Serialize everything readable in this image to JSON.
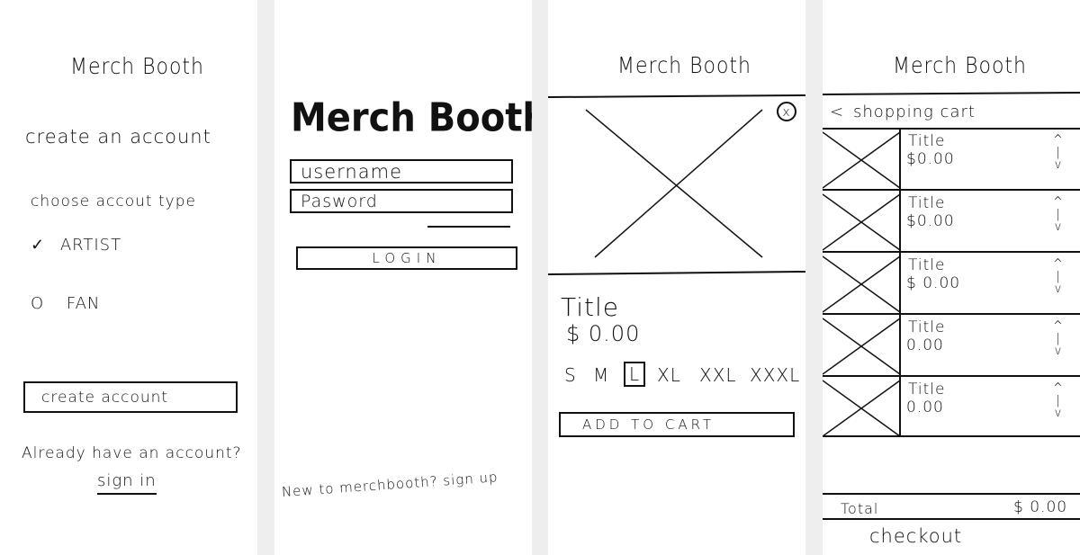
{
  "signup": {
    "brand": "Merch Booth",
    "heading": "create an account",
    "account_type_label": "choose accout type",
    "options": [
      {
        "mark": "✓",
        "label": "ARTIST"
      },
      {
        "mark": "O",
        "label": "FAN"
      }
    ],
    "create_button": "create account",
    "already_text": "Already have an account?",
    "sign_in_link": "sign in"
  },
  "login": {
    "brand": "Merch Booth",
    "username_placeholder": "username",
    "password_placeholder": "Pasword",
    "login_button": "LOGIN",
    "footer_text": "New to merchbooth? sign up"
  },
  "product": {
    "brand": "Merch Booth",
    "close_glyph": "x",
    "title": "Title",
    "price": "$ 0.00",
    "sizes": [
      {
        "label": "S",
        "selected": false
      },
      {
        "label": "M",
        "selected": false
      },
      {
        "label": "L",
        "selected": true
      },
      {
        "label": "XL",
        "selected": false
      },
      {
        "label": "XXL",
        "selected": false
      },
      {
        "label": "XXXL",
        "selected": false
      }
    ],
    "add_to_cart": "ADD TO CART"
  },
  "cart": {
    "brand": "Merch Booth",
    "back_glyph": "<",
    "heading": "shopping cart",
    "items": [
      {
        "title": "Title",
        "price": "$0.00"
      },
      {
        "title": "Title",
        "price": "$0.00"
      },
      {
        "title": "Title",
        "price": "$ 0.00"
      },
      {
        "title": "Title",
        "price": "0.00"
      },
      {
        "title": "Title",
        "price": "0.00"
      }
    ],
    "qty_glyph": "^\n|\nv",
    "total_label": "Total",
    "total_value": "$ 0.00",
    "checkout": "checkout"
  }
}
